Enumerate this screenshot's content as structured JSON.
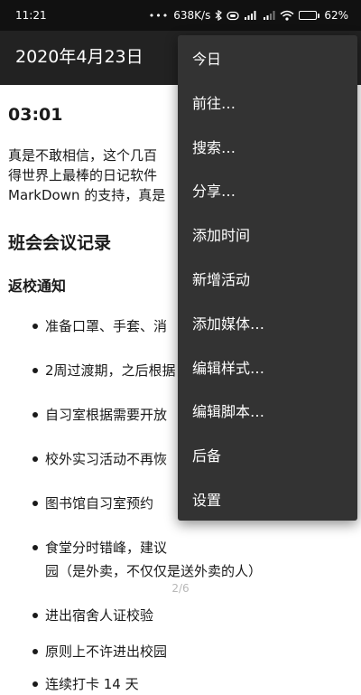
{
  "status_bar": {
    "time": "11:21",
    "dots": "•••",
    "speed": "638K/s",
    "battery_percent": "62%",
    "battery_level": 0.62
  },
  "app_bar": {
    "title": "2020年4月23日"
  },
  "document": {
    "time_heading": "03:01",
    "paragraph_lines": [
      "真是不敢相信，这个几百",
      "得世界上最棒的日记软件",
      "MarkDown 的支持，真是"
    ],
    "section_heading": "班会会议记录",
    "subsection_heading": "返校通知",
    "list_items": [
      "准备口罩、手套、消",
      "2周过渡期，之后根据",
      "自习室根据需要开放",
      "校外实习活动不再恢",
      "图书馆自习室预约",
      "食堂分时错峰，建议",
      "园（是外卖，不仅仅是送外卖的人）",
      "进出宿舍人证校验",
      "原则上不许进出校园",
      "连续打卡 14 天"
    ],
    "page_indicator": "2/6"
  },
  "menu": {
    "items": [
      "今日",
      "前往…",
      "搜索…",
      "分享…",
      "添加时间",
      "新增活动",
      "添加媒体…",
      "编辑样式…",
      "编辑脚本…",
      "后备",
      "设置"
    ]
  }
}
